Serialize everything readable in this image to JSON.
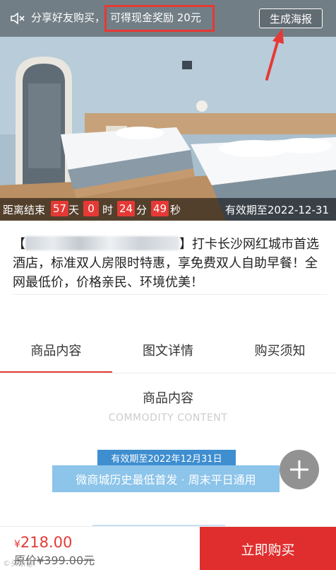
{
  "share_bar": {
    "text": "分享好友购买，",
    "reward": "可得现金奖励 20元",
    "poster_button": "生成海报"
  },
  "countdown": {
    "label": "距离结束",
    "days": "57",
    "days_unit": "天",
    "hours": "0",
    "hours_unit": "时",
    "minutes": "24",
    "minutes_unit": "分",
    "seconds": "49",
    "seconds_unit": "秒",
    "valid_until": "有效期至2022-12-31"
  },
  "description": {
    "bracket_open": "【",
    "bracket_close": "】",
    "text": "打卡长沙网红城市首选酒店，标准双人房限时特惠，享免费双人自助早餐！全网最低价，价格亲民、环境优美！"
  },
  "tabs": [
    {
      "label": "商品内容",
      "active": true
    },
    {
      "label": "图文详情",
      "active": false
    },
    {
      "label": "购买须知",
      "active": false
    }
  ],
  "section": {
    "title": "商品内容",
    "subtitle": "COMMODITY CONTENT"
  },
  "promo": {
    "tag": "有效期至2022年12月31日",
    "card": "微商城历史最低首发 · 周末平日通用"
  },
  "footer": {
    "currency": "¥",
    "price": "218.00",
    "original_price": "原价¥399.00元",
    "buy_button": "立即购买"
  },
  "watermark": "©头条@",
  "colors": {
    "accent_red": "#e53935",
    "buy_button": "#e02e2e",
    "promo_blue": "#3e8ed0",
    "promo_light": "#8cc4ea"
  },
  "icons": {
    "speaker": "speaker-muted-icon",
    "arrow": "red-arrow-icon",
    "plus": "plus-icon"
  }
}
